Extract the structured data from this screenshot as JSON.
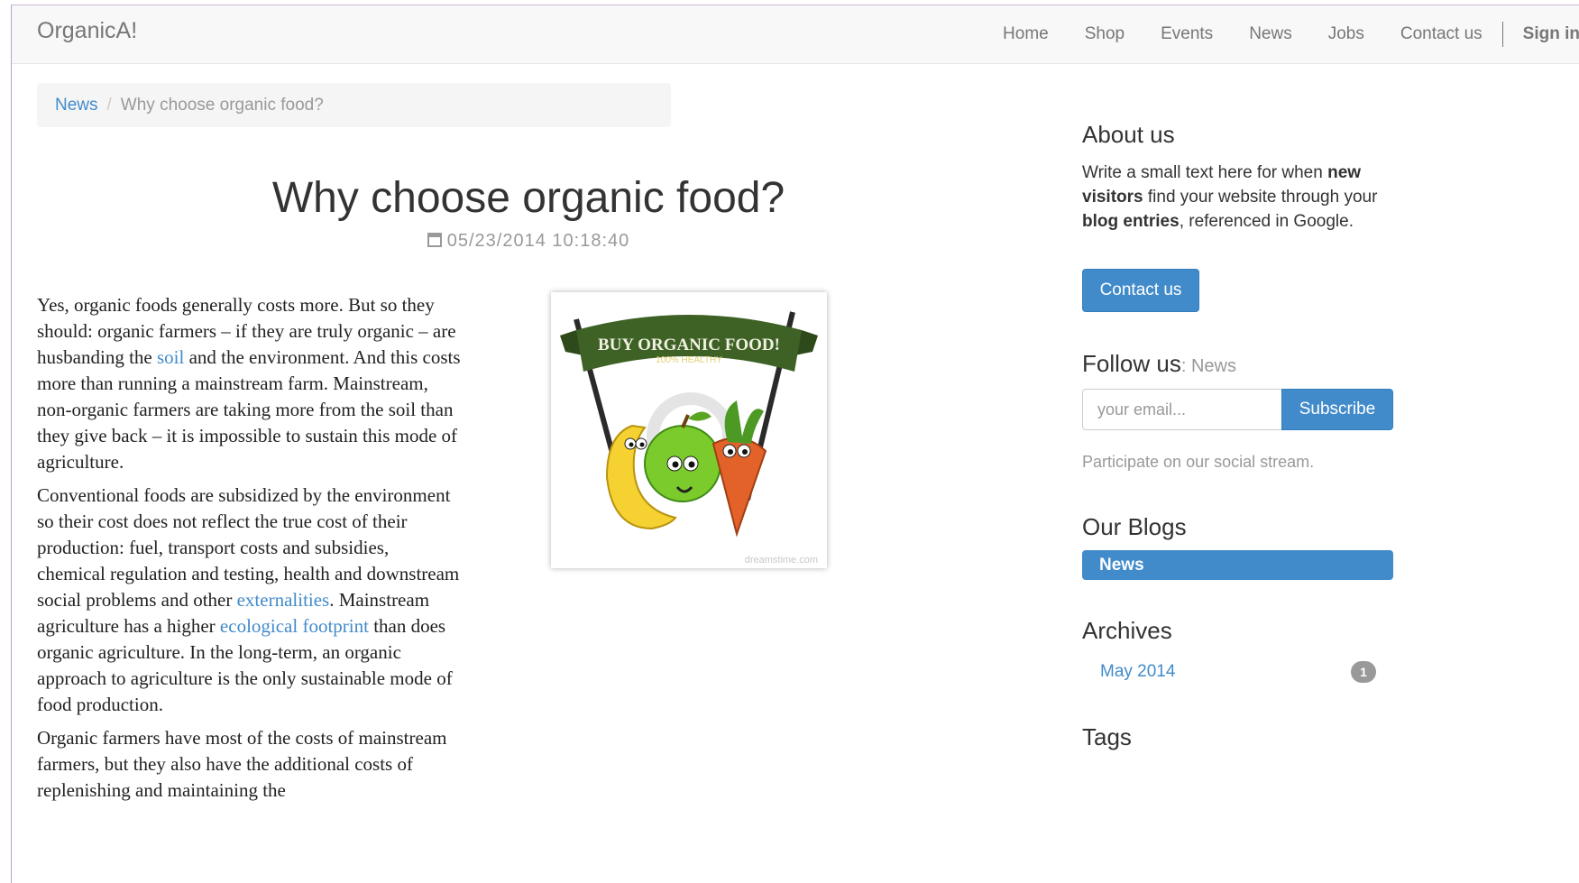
{
  "navbar": {
    "brand": "OrganicA!",
    "links": [
      "Home",
      "Shop",
      "Events",
      "News",
      "Jobs",
      "Contact us"
    ],
    "signin": "Sign in"
  },
  "breadcrumb": {
    "link": "News",
    "separator": "/",
    "active": "Why choose organic food?"
  },
  "post": {
    "title": "Why choose organic food?",
    "date": "05/23/2014 10:18:40",
    "image": {
      "banner_main": "BUY ORGANIC FOOD!",
      "banner_sub": "100% HEALTHY",
      "watermark": "dreamstime.com"
    },
    "p1": {
      "t1": "Yes, organic foods generally costs more. But so they should: organic farmers – if they are truly organic – are husbanding the ",
      "link1": "soil",
      "t2": " and the environment. And this costs more than running a mainstream farm. Mainstream, non-organic farmers are taking more from the soil than they give back – it is impossible to sustain this mode of agriculture."
    },
    "p2": {
      "t1": "Conventional foods are subsidized by the environment so their cost does not reflect the true cost of their production: fuel, transport costs and subsidies, chemical regulation and testing, health and downstream social problems and other ",
      "link1": "externalities",
      "t2": ". Mainstream agriculture has a higher ",
      "link2": "ecological footprint",
      "t3": " than does organic agriculture. In the long-term, an organic approach to agriculture is the only sustainable mode of food production."
    },
    "p3": {
      "t1": "Organic farmers have most of the costs of mainstream farmers, but they also have the additional costs of replenishing and maintaining the"
    }
  },
  "sidebar": {
    "about": {
      "heading": "About us",
      "t1": "Write a small text here for when ",
      "b1": "new visitors",
      "t2": " find your website through your ",
      "b2": "blog entries",
      "t3": ", referenced in Google.",
      "button": "Contact us"
    },
    "follow": {
      "heading": "Follow us",
      "sub": ": News",
      "placeholder": "your email...",
      "button": "Subscribe",
      "social": "Participate on our social stream."
    },
    "blogs": {
      "heading": "Our Blogs",
      "items": [
        "News"
      ]
    },
    "archives": {
      "heading": "Archives",
      "items": [
        {
          "label": "May 2014",
          "count": "1"
        }
      ]
    },
    "tags": {
      "heading": "Tags"
    }
  }
}
